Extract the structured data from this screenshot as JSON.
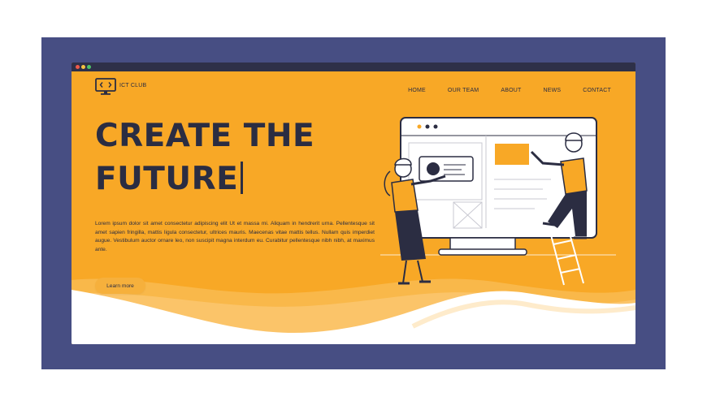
{
  "brand": {
    "name": "ICT CLUB",
    "icon": "code-monitor-icon"
  },
  "nav": [
    "HOME",
    "OUR TEAM",
    "ABOUT",
    "NEWS",
    "CONTACT"
  ],
  "hero": {
    "headline_line1": "CREATE THE",
    "headline_line2": "FUTURE",
    "paragraph": "Lorem ipsum dolor sit amet consectetur adipiscing elit Ut et massa mi. Aliquam in hendrerit urna. Pellentesque sit amet sapien fringilla, mattis ligula consectetur, ultrices mauris. Maecenas vitae mattis tellus. Nullam quis imperdiet augue. Vestibulum auctor ornare leo, non suscipit magna interdum eu. Curabitur pellentesque nibh nibh, at maximus ante.",
    "cta_label": "Learn more"
  },
  "colors": {
    "frame": "#474e83",
    "background": "#f8a826",
    "text": "#2b2d42",
    "wave_light": "#fbc469",
    "wave_white": "#ffffff"
  }
}
